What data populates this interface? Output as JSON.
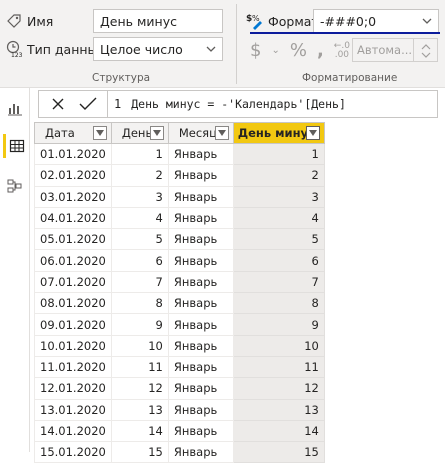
{
  "structure": {
    "name_label": "Имя",
    "name_value": "День минус",
    "datatype_label": "Тип данных",
    "datatype_value": "Целое число",
    "caption": "Структура"
  },
  "formatting": {
    "format_label": "Формат",
    "format_value": "-###0;0",
    "auto_label": "Автома...",
    "caption": "Форматирование",
    "icons": [
      "currency-icon",
      "percent-icon",
      "comma-icon",
      "decimals-icon"
    ]
  },
  "rail": {
    "icons": [
      "report-view-icon",
      "data-view-icon",
      "model-view-icon"
    ],
    "active": "data-view-icon"
  },
  "formula": {
    "line_number": "1",
    "expression": "День минус = -'Календарь'[День]"
  },
  "table": {
    "columns": [
      "Дата",
      "День",
      "Месяц",
      "День минус"
    ],
    "selected_column": "День минус",
    "rows": [
      [
        "01.01.2020",
        "1",
        "Январь",
        "1"
      ],
      [
        "02.01.2020",
        "2",
        "Январь",
        "2"
      ],
      [
        "03.01.2020",
        "3",
        "Январь",
        "3"
      ],
      [
        "04.01.2020",
        "4",
        "Январь",
        "4"
      ],
      [
        "05.01.2020",
        "5",
        "Январь",
        "5"
      ],
      [
        "06.01.2020",
        "6",
        "Январь",
        "6"
      ],
      [
        "07.01.2020",
        "7",
        "Январь",
        "7"
      ],
      [
        "08.01.2020",
        "8",
        "Январь",
        "8"
      ],
      [
        "09.01.2020",
        "9",
        "Январь",
        "9"
      ],
      [
        "10.01.2020",
        "10",
        "Январь",
        "10"
      ],
      [
        "11.01.2020",
        "11",
        "Январь",
        "11"
      ],
      [
        "12.01.2020",
        "12",
        "Январь",
        "12"
      ],
      [
        "13.01.2020",
        "13",
        "Январь",
        "13"
      ],
      [
        "14.01.2020",
        "14",
        "Январь",
        "14"
      ],
      [
        "15.01.2020",
        "15",
        "Январь",
        "15"
      ]
    ]
  },
  "colors": {
    "accent_yellow": "#f2c811",
    "format_underline": "#0c1c9c"
  }
}
